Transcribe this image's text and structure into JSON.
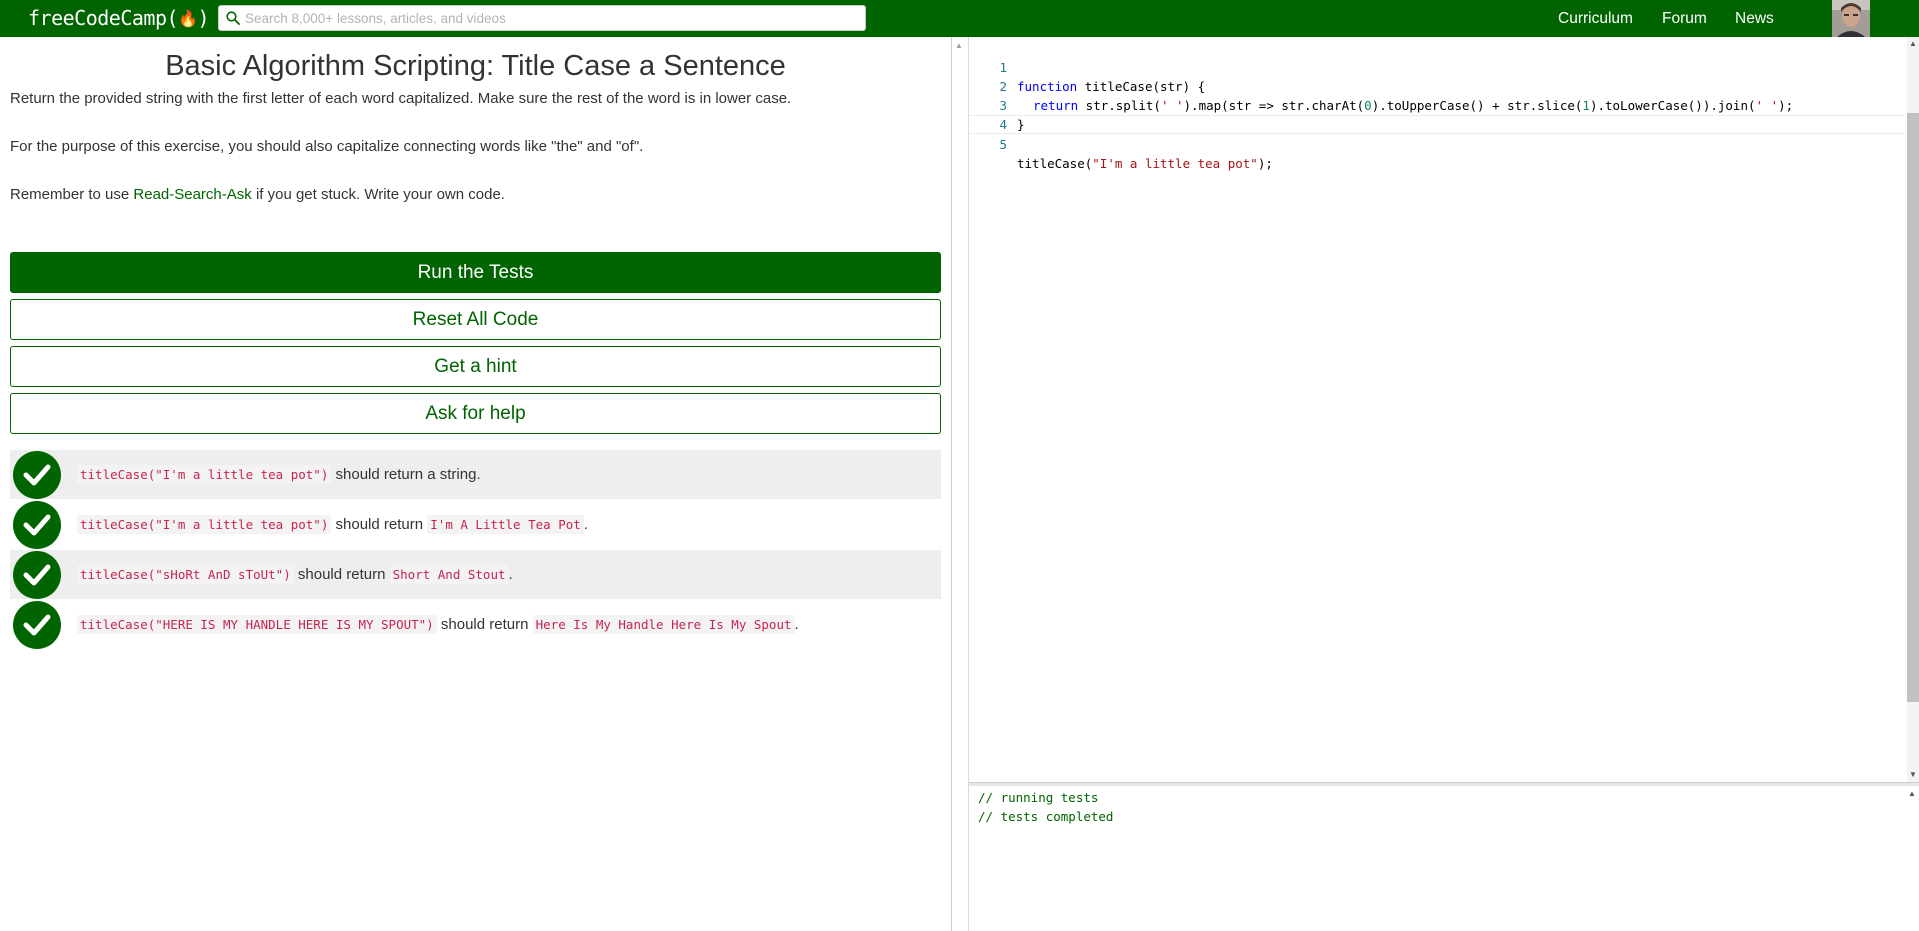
{
  "nav": {
    "logo_text": "freeCodeCamp(",
    "logo_close": ")",
    "search_placeholder": "Search 8,000+ lessons, articles, and videos",
    "links": [
      "Curriculum",
      "Forum",
      "News"
    ]
  },
  "challenge": {
    "title": "Basic Algorithm Scripting: Title Case a Sentence",
    "description": "Return the provided string with the first letter of each word capitalized. Make sure the rest of the word is in lower case.",
    "note": "For the purpose of this exercise, you should also capitalize connecting words like \"the\" and \"of\".",
    "reminder_before": "Remember to use ",
    "reminder_link": "Read-Search-Ask",
    "reminder_after": " if you get stuck. Write your own code."
  },
  "buttons": {
    "run": "Run the Tests",
    "reset": "Reset All Code",
    "hint": "Get a hint",
    "help": "Ask for help"
  },
  "tests": [
    {
      "code": "titleCase(\"I'm a little tea pot\")",
      "text": "should return a string.",
      "expected": "",
      "tail": ""
    },
    {
      "code": "titleCase(\"I'm a little tea pot\")",
      "text": "should return",
      "expected": "I'm A Little Tea Pot",
      "tail": "."
    },
    {
      "code": "titleCase(\"sHoRt AnD sToUt\")",
      "text": "should return",
      "expected": "Short And Stout",
      "tail": "."
    },
    {
      "code": "titleCase(\"HERE IS MY HANDLE HERE IS MY SPOUT\")",
      "text": "should return",
      "expected": "Here Is My Handle Here Is My Spout",
      "tail": "."
    }
  ],
  "editor": {
    "line_numbers": [
      "1",
      "2",
      "3",
      "4",
      "5"
    ],
    "line1": {
      "kw": "function",
      "rest": " titleCase(str) {"
    },
    "line2": {
      "kw": "return",
      "a": " str.split(",
      "s1": "' '",
      "b": ").map(str => str.charAt(",
      "n0": "0",
      "c": ").toUpperCase() + str.slice(",
      "n1": "1",
      "d": ").toLowerCase()).join(",
      "s2": "' '",
      "e": ");"
    },
    "line3": "}",
    "line5": {
      "a": "titleCase(",
      "s": "\"I'm a little tea pot\"",
      "b": ");"
    }
  },
  "console": {
    "lines": [
      "// running tests",
      "// tests completed"
    ]
  },
  "colors": {
    "brand_green": "#006400",
    "code_red": "#c7254e"
  }
}
